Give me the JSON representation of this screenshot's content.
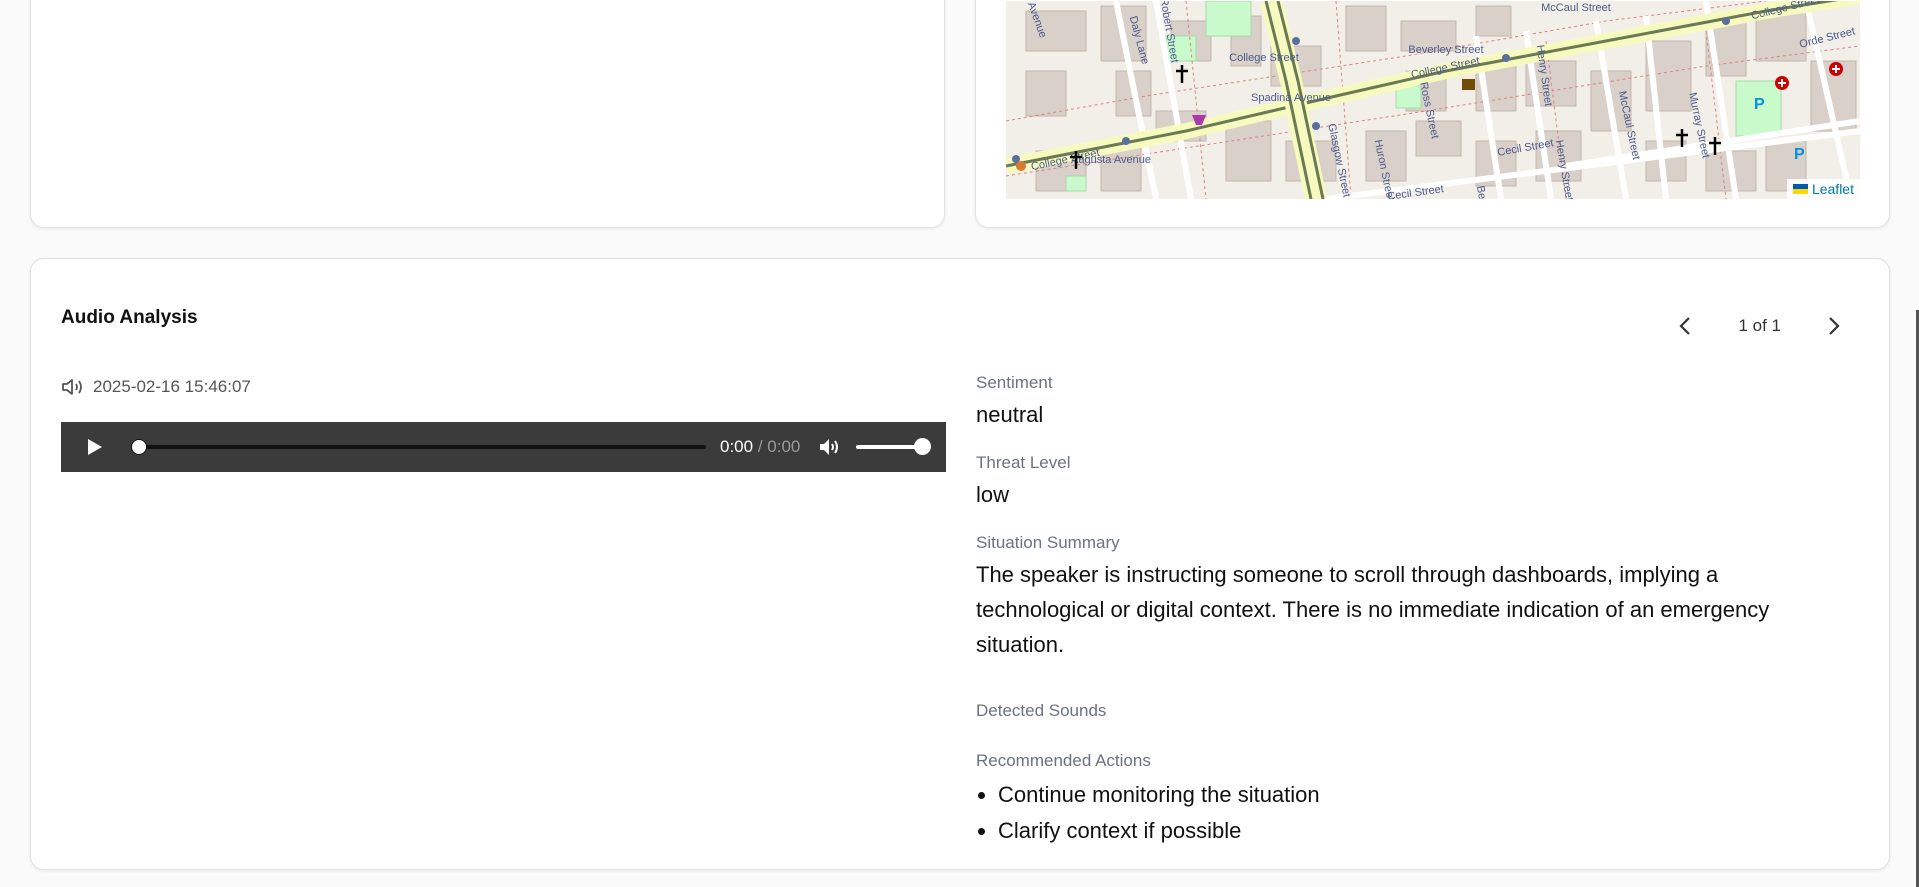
{
  "map": {
    "labels": [
      "College Street",
      "College Street",
      "College Street",
      "College Street",
      "Spadina Avenue",
      "Augusta Avenue",
      "Beverley Street",
      "McCaul Street",
      "Robert Street",
      "Daly Lane",
      "Henry Street",
      "Henry Street",
      "Ross Street",
      "Huron Street",
      "Glasgow Street",
      "Cecil Street",
      "Cecil Street",
      "McCaul Street",
      "Murray Street",
      "Orde Street",
      "Avenue",
      "Be"
    ],
    "attribution": "Leaflet",
    "flag_colors": [
      "#0057b7",
      "#ffd700"
    ]
  },
  "audio_analysis": {
    "title": "Audio Analysis",
    "pager": {
      "text": "1 of 1",
      "prev_icon": "chevron-left-icon",
      "next_icon": "chevron-right-icon"
    },
    "recording": {
      "timestamp": "2025-02-16 15:46:07",
      "icon": "speaker-icon",
      "current_time": "0:00",
      "separator": "/",
      "duration": "0:00",
      "progress": 0,
      "volume": 1.0
    },
    "fields": {
      "sentiment_label": "Sentiment",
      "sentiment_value": "neutral",
      "threat_label": "Threat Level",
      "threat_value": "low",
      "summary_label": "Situation Summary",
      "summary_value": "The speaker is instructing someone to scroll through dashboards, implying a technological or digital context. There is no immediate indication of an emergency situation.",
      "sounds_label": "Detected Sounds",
      "actions_label": "Recommended Actions"
    },
    "actions": [
      "Continue monitoring the situation",
      "Clarify context if possible"
    ]
  },
  "colors": {
    "player_bg": "#3b3b3b",
    "label_gray": "#6b7280",
    "map_bg": "#f2efe9",
    "road_major": "#f7fabf",
    "tram_line": "#6b7a52",
    "link_blue": "#0078a8"
  }
}
